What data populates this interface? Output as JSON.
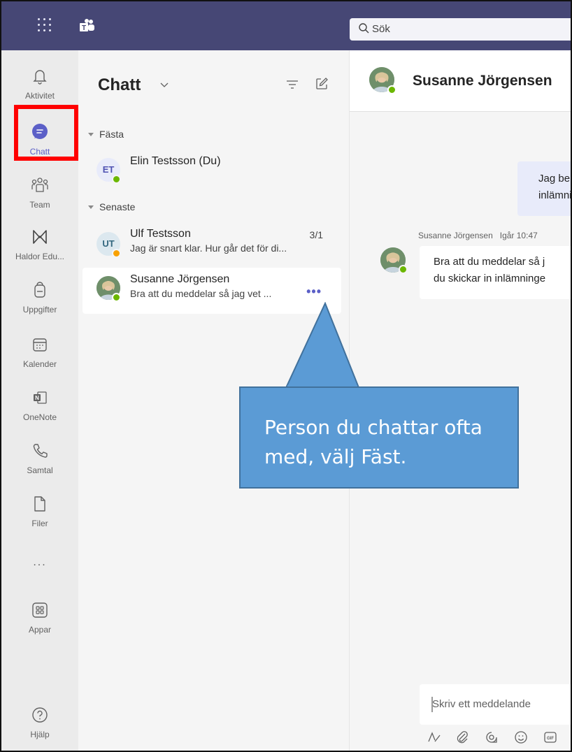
{
  "topbar": {
    "search_placeholder": "Sök",
    "bg": "#464775"
  },
  "rail": {
    "items": [
      {
        "label": "Aktivitet",
        "icon": "bell-icon"
      },
      {
        "label": "Chatt",
        "icon": "chat-icon"
      },
      {
        "label": "Team",
        "icon": "team-icon"
      },
      {
        "label": "Haldor Edu...",
        "icon": "haldor-icon"
      },
      {
        "label": "Uppgifter",
        "icon": "backpack-icon"
      },
      {
        "label": "Kalender",
        "icon": "calendar-icon"
      },
      {
        "label": "OneNote",
        "icon": "onenote-icon"
      },
      {
        "label": "Samtal",
        "icon": "phone-icon"
      },
      {
        "label": "Filer",
        "icon": "file-icon"
      },
      {
        "label": "...",
        "icon": "more-icon"
      },
      {
        "label": "Appar",
        "icon": "apps-icon"
      },
      {
        "label": "Hjälp",
        "icon": "help-icon"
      }
    ],
    "active_color": "#5b5fc7"
  },
  "chatlist": {
    "title": "Chatt",
    "sections": {
      "pinned": "Fästa",
      "recent": "Senaste"
    },
    "pinned": [
      {
        "initials": "ET",
        "name": "Elin Testsson (Du)",
        "preview": "",
        "date": ""
      }
    ],
    "recent": [
      {
        "initials": "UT",
        "name": "Ulf Testsson",
        "preview": "Jag är snart klar. Hur går det för di...",
        "date": "3/1"
      },
      {
        "initials": "",
        "name": "Susanne Jörgensen",
        "preview": "Bra att du meddelar så jag vet ...",
        "date": "",
        "more": "•••"
      }
    ]
  },
  "main": {
    "contact_name": "Susanne Jörgensen",
    "my_message": {
      "line1": "Jag beh",
      "line2": "inlämni"
    },
    "their_message": {
      "sender": "Susanne Jörgensen",
      "time": "Igår 10:47",
      "line1": "Bra att du meddelar så j",
      "line2": "du skickar in inlämninge"
    },
    "compose_placeholder": "Skriv ett meddelande"
  },
  "callout": {
    "text": "Person du chattar ofta med, välj Fäst.",
    "fill": "#5b9bd5",
    "border": "#41719c"
  },
  "highlight_color": "#ff0000"
}
